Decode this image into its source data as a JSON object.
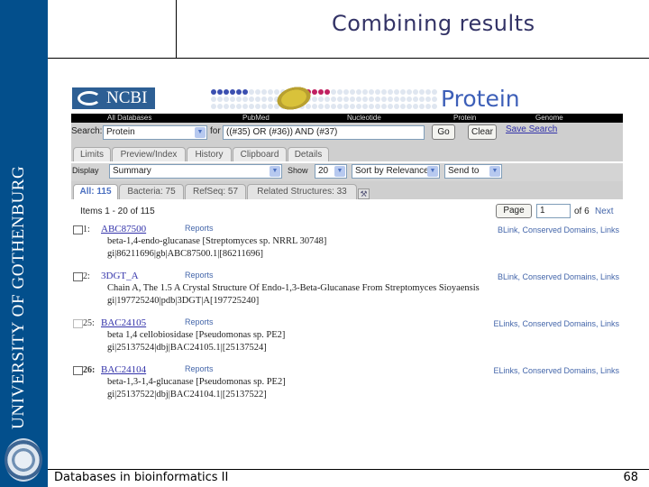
{
  "slide": {
    "title": "Combining results",
    "sidebar_text": "UNIVERSITY OF GOTHENBURG",
    "footer": "Databases in bioinformatics II",
    "page_number": "68",
    "colors": {
      "sidebar": "#034f8c",
      "title": "#333366"
    }
  },
  "ncbi": {
    "logo_text": "NCBI",
    "banner_title": "Protein",
    "nav": [
      "All Databases",
      "PubMed",
      "Nucleotide",
      "Protein",
      "Genome"
    ],
    "search": {
      "label": "Search:",
      "database": "Protein",
      "for_label": "for",
      "query": "((#35) OR (#36)) AND (#37)",
      "go_label": "Go",
      "clear_label": "Clear",
      "save_search_label": "Save Search"
    },
    "tabs": [
      "Limits",
      "Preview/Index",
      "History",
      "Clipboard",
      "Details"
    ],
    "display": {
      "display_label": "Display",
      "display_value": "Summary",
      "show_label": "Show",
      "show_value": "20",
      "sort_value": "Sort by Relevance",
      "send_value": "Send to"
    },
    "filter_tabs": [
      {
        "label": "All: 115",
        "active": true
      },
      {
        "label": "Bacteria: 75",
        "active": false
      },
      {
        "label": "RefSeq: 57",
        "active": false
      },
      {
        "label": "Related Structures: 33",
        "active": false
      }
    ],
    "pager": {
      "items_text": "Items 1 - 20 of 115",
      "page_button": "Page",
      "page_value": "1",
      "of_text": "of 6",
      "next_label": "Next"
    },
    "results": [
      {
        "num": "1:",
        "accession": "ABC87500",
        "reports": "Reports",
        "links": "BLink, Conserved Domains, Links",
        "description": "beta-1,4-endo-glucanase [Streptomyces sp. NRRL 30748]",
        "gi": "gi|86211696|gb|ABC87500.1|[86211696]"
      },
      {
        "num": "2:",
        "accession": "3DGT_A",
        "reports": "Reports",
        "links": "BLink, Conserved Domains, Links",
        "description": "Chain A, The 1.5 A Crystal Structure Of Endo-1,3-Beta-Glucanase From Streptomyces Sioyaensis",
        "gi": "gi|197725240|pdb|3DGT|A[197725240]"
      },
      {
        "num": "25:",
        "accession": "BAC24105",
        "reports": "Reports",
        "links": "ELinks, Conserved Domains, Links",
        "description": "beta 1,4 cellobiosidase [Pseudomonas sp. PE2]",
        "gi": "gi|25137524|dbj|BAC24105.1|[25137524]"
      },
      {
        "num": "26:",
        "accession": "BAC24104",
        "reports": "Reports",
        "links": "ELinks, Conserved Domains, Links",
        "description": "beta-1,3-1,4-glucanase [Pseudomonas sp. PE2]",
        "gi": "gi|25137522|dbj|BAC24104.1|[25137522]"
      }
    ]
  }
}
